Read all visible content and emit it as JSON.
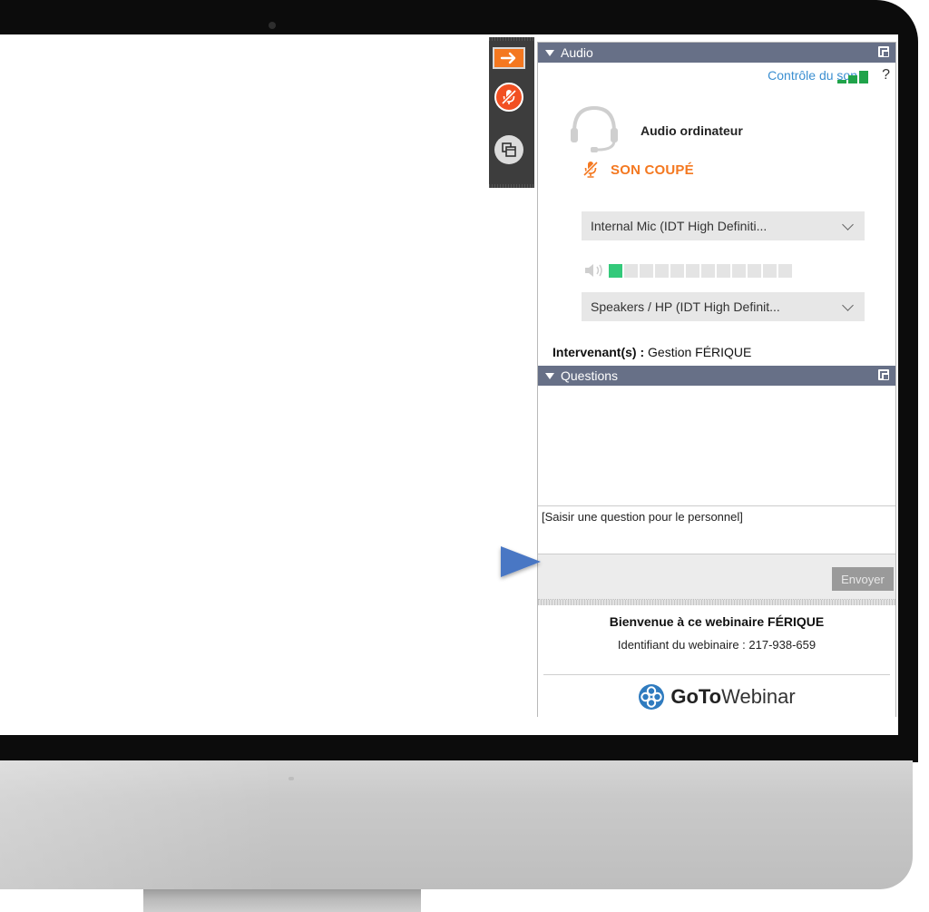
{
  "audio_panel": {
    "title": "Audio",
    "sound_check_label": "Contrôle du son",
    "help_label": "?",
    "computer_audio_label": "Audio ordinateur",
    "muted_label": "SON COUPÉ",
    "microphone_select": "Internal Mic (IDT High Definiti...",
    "speaker_select": "Speakers / HP (IDT High Definit...",
    "speaker_level": 0.08,
    "speaker_level_segments": 12,
    "presenters_label": "Intervenant(s) :",
    "presenters_value": "Gestion FÉRIQUE"
  },
  "questions_panel": {
    "title": "Questions",
    "input_placeholder": "[Saisir une question pour le personnel]",
    "send_label": "Envoyer"
  },
  "welcome": {
    "title": "Bienvenue à ce webinaire FÉRIQUE",
    "webinar_id": "Identifiant du webinaire : 217-938-659"
  },
  "brand": {
    "goto": "GoTo",
    "webinar": "Webinar"
  },
  "colors": {
    "panel_header": "#677087",
    "accent_orange": "#f47820",
    "muted_red": "#f25022",
    "link_blue": "#3b8fd1",
    "signal_green": "#20a34a",
    "vu_green": "#33c97a",
    "callout_blue": "#4a77c4"
  },
  "icons": {
    "toolbar_toggle": "arrow-right-icon",
    "toolbar_mic": "muted-microphone-icon",
    "toolbar_screen": "screen-share-icon",
    "headset": "headset-icon",
    "speaker": "speaker-icon",
    "logo": "gotowebinar-logo-icon"
  }
}
